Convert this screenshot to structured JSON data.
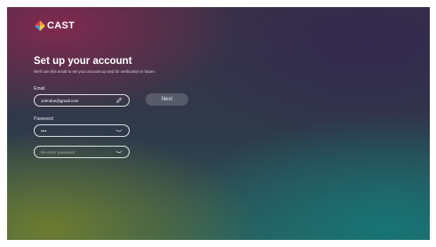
{
  "app": {
    "logo_text": "CAST"
  },
  "header": {
    "title": "Set up your account",
    "subtitle": "We'll use this email to set your account up and for verification in future."
  },
  "form": {
    "email_label": "Email",
    "email_value": "Johndoe@gmail.com",
    "password_label": "Password",
    "password_value": "••••",
    "reenter_placeholder": "Re-enter password",
    "next_label": "Next"
  },
  "icons": {
    "email_field_icon": "edit-icon",
    "password_field_icon": "eye-closed-icon",
    "reenter_field_icon": "eye-closed-icon"
  },
  "colors": {
    "logo_red": "#e04050",
    "logo_orange": "#f0a030",
    "logo_blue": "#4aa0e0",
    "logo_yellow": "#f6d23a",
    "button_bg": "rgba(255,255,255,0.18)"
  }
}
